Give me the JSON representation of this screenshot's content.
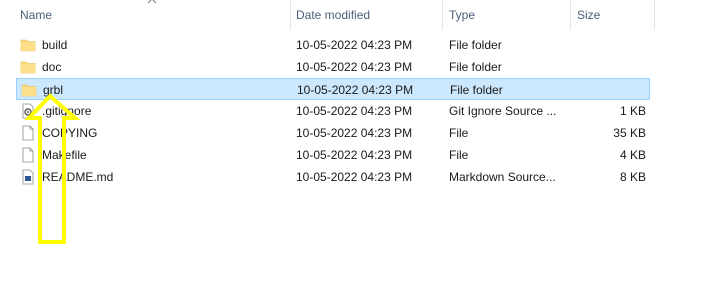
{
  "columns": {
    "name": "Name",
    "date": "Date modified",
    "type": "Type",
    "size": "Size"
  },
  "files": [
    {
      "name": "build",
      "date": "10-05-2022 04:23 PM",
      "type": "File folder",
      "size": "",
      "icon": "folder-icon"
    },
    {
      "name": "doc",
      "date": "10-05-2022 04:23 PM",
      "type": "File folder",
      "size": "",
      "icon": "folder-icon"
    },
    {
      "name": "grbl",
      "date": "10-05-2022 04:23 PM",
      "type": "File folder",
      "size": "",
      "icon": "folder-icon",
      "selected": true
    },
    {
      "name": ".gitignore",
      "date": "10-05-2022 04:23 PM",
      "type": "Git Ignore Source ...",
      "size": "1 KB",
      "icon": "gear-file-icon"
    },
    {
      "name": "COPYING",
      "date": "10-05-2022 04:23 PM",
      "type": "File",
      "size": "35 KB",
      "icon": "blank-file-icon"
    },
    {
      "name": "Makefile",
      "date": "10-05-2022 04:23 PM",
      "type": "File",
      "size": "4 KB",
      "icon": "blank-file-icon"
    },
    {
      "name": "README.md",
      "date": "10-05-2022 04:23 PM",
      "type": "Markdown Source...",
      "size": "8 KB",
      "icon": "markdown-file-icon"
    }
  ],
  "colors": {
    "selection_bg": "#cce8ff",
    "selection_border": "#99d1ff",
    "folder": "#f8d775",
    "annotation_arrow": "#ffff00"
  }
}
